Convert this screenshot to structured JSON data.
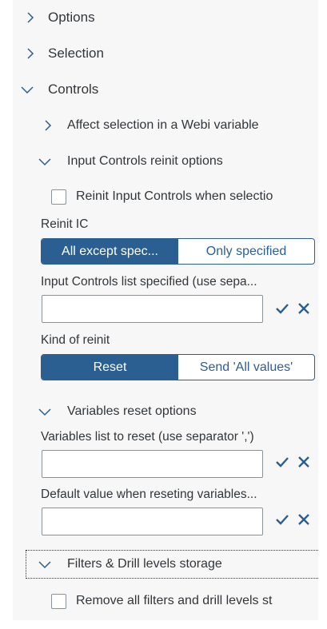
{
  "colors": {
    "accent": "#2b5f92",
    "panel_bg": "#f7f7f7",
    "text": "#32363a"
  },
  "tree": {
    "options": {
      "label": "Options",
      "icon": "chevron-right-icon"
    },
    "selection": {
      "label": "Selection",
      "icon": "chevron-right-icon"
    },
    "controls": {
      "label": "Controls",
      "icon": "chevron-down-icon"
    },
    "affect_selection": {
      "label": "Affect selection in a Webi variable",
      "icon": "chevron-right-icon"
    },
    "input_controls_reinit": {
      "label": "Input Controls reinit options",
      "icon": "chevron-down-icon"
    },
    "variables_reset": {
      "label": "Variables reset options",
      "icon": "chevron-down-icon"
    },
    "filters_drill": {
      "label": "Filters & Drill levels storage",
      "icon": "chevron-down-icon"
    }
  },
  "reinit_checkbox": {
    "label": "Reinit Input Controls when selectio",
    "checked": false
  },
  "reinit_ic": {
    "label": "Reinit IC",
    "options": [
      "All except spec...",
      "Only specified"
    ],
    "selected": "All except spec..."
  },
  "ic_list": {
    "label": "Input Controls list specified (use sepa...",
    "value": ""
  },
  "kind_of_reinit": {
    "label": "Kind of reinit",
    "options": [
      "Reset",
      "Send 'All values'"
    ],
    "selected": "Reset"
  },
  "variables_list": {
    "label": "Variables list to reset (use separator ',')",
    "value": ""
  },
  "default_value": {
    "label": "Default value when reseting variables...",
    "value": ""
  },
  "remove_filters_checkbox": {
    "label": "Remove all filters and drill levels st",
    "checked": false
  },
  "actions": {
    "confirm_icon": "check-icon",
    "cancel_icon": "close-icon"
  }
}
